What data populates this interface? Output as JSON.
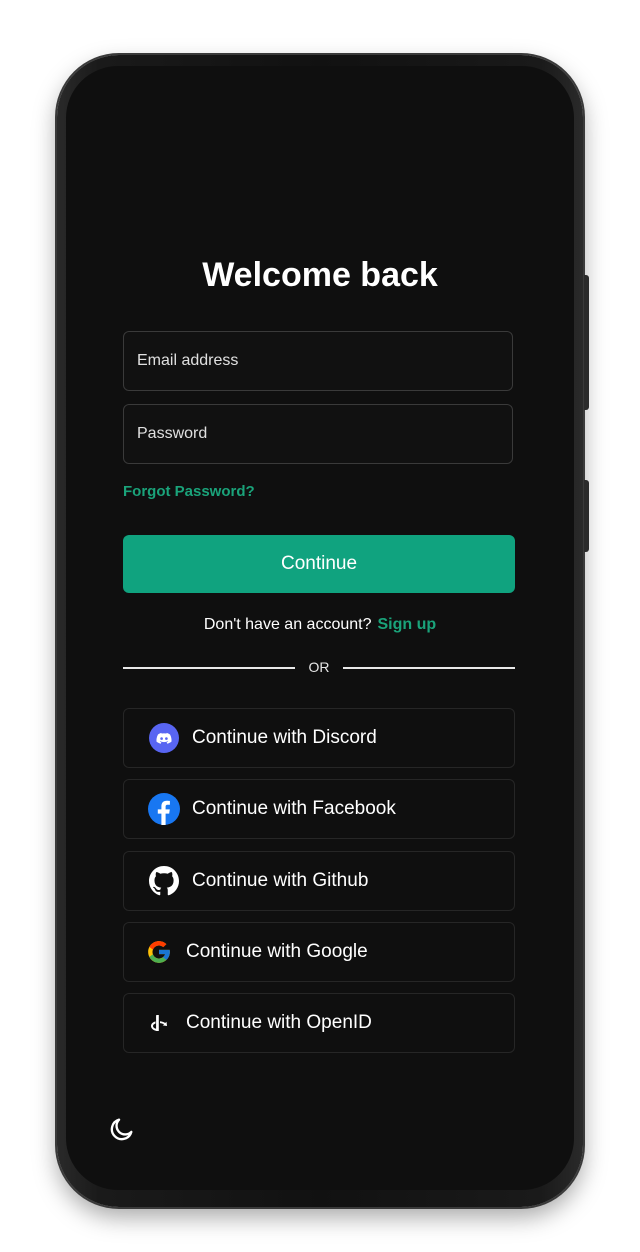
{
  "page": {
    "title": "Welcome back"
  },
  "form": {
    "email_placeholder": "Email address",
    "email_value": "",
    "password_placeholder": "Password",
    "password_value": "",
    "forgot_label": "Forgot Password?",
    "continue_label": "Continue"
  },
  "signup": {
    "prompt": "Don't have an account?",
    "link_label": "Sign up"
  },
  "divider": {
    "label": "OR"
  },
  "social": [
    {
      "label": "Continue with Discord",
      "icon": "discord-icon"
    },
    {
      "label": "Continue with Facebook",
      "icon": "facebook-icon"
    },
    {
      "label": "Continue with Github",
      "icon": "github-icon"
    },
    {
      "label": "Continue with Google",
      "icon": "google-icon"
    },
    {
      "label": "Continue with OpenID",
      "icon": "openid-icon"
    }
  ],
  "footer": {
    "theme_toggle_icon": "moon-icon"
  },
  "colors": {
    "accent": "#10a37f",
    "link": "#1aa37a",
    "background": "#0f0f0f",
    "discord": "#5865f2",
    "facebook": "#1877f2"
  }
}
